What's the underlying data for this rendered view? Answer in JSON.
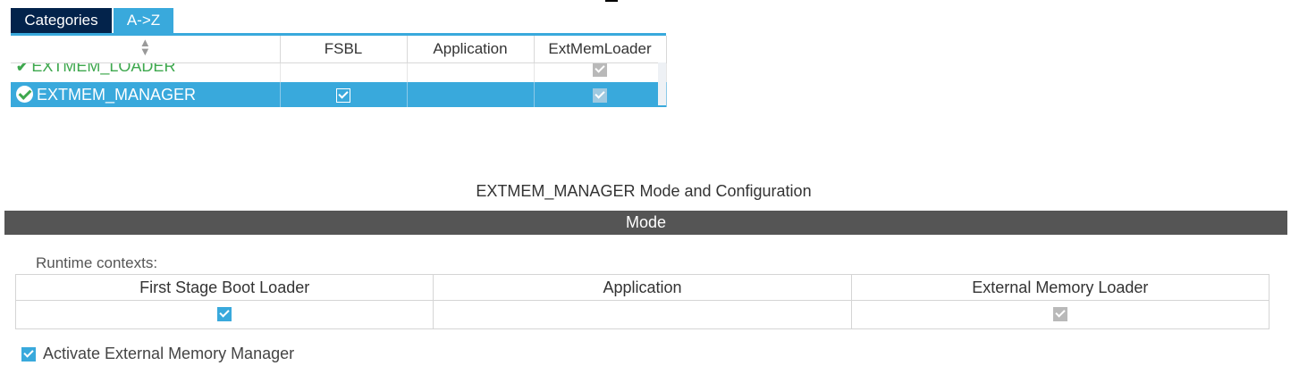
{
  "tabs": [
    {
      "label": "Categories",
      "active": false
    },
    {
      "label": "A->Z",
      "active": true
    }
  ],
  "component_table": {
    "sort_icon": "sort-icon",
    "columns": [
      "FSBL",
      "Application",
      "ExtMemLoader"
    ],
    "rows": [
      {
        "name": "EXTMEM_LOADER",
        "status": "check-icon",
        "fsbl": false,
        "application": false,
        "extmemloader": true,
        "selected": false
      },
      {
        "name": "EXTMEM_MANAGER",
        "status": "check-circle-icon",
        "fsbl": true,
        "application": false,
        "extmemloader": true,
        "selected": true
      }
    ]
  },
  "config": {
    "title": "EXTMEM_MANAGER Mode and Configuration",
    "mode_header": "Mode",
    "runtime_label": "Runtime contexts:",
    "contexts": [
      {
        "label": "First Stage Boot Loader",
        "checked": true,
        "enabled": true
      },
      {
        "label": "Application",
        "checked": false,
        "enabled": true
      },
      {
        "label": "External Memory Loader",
        "checked": true,
        "enabled": false
      }
    ],
    "activate_label": "Activate External Memory Manager",
    "activate_checked": true
  },
  "colors": {
    "tab_dark": "#03234b",
    "accent": "#39a9dc",
    "mode_bar": "#555555",
    "status_green": "#3ea84e",
    "disabled_check": "#b9b9b9"
  }
}
